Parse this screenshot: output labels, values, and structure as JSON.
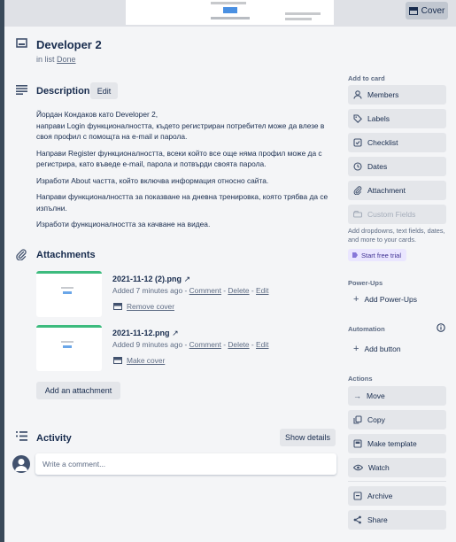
{
  "header": {
    "cover_label": "Cover"
  },
  "card": {
    "title": "Developer 2",
    "list_prefix": "in list",
    "list_name": "Done"
  },
  "description": {
    "title": "Description",
    "edit_label": "Edit",
    "paragraphs": [
      "Йордан Кондаков като Developer 2,",
      "направи Login функционалността, където регистриран потребител може да влезе в своя профил с помощта на e-mail и парола.",
      "Направи Register функционалността, всеки който все още няма профил може да с регистрира, като въведе e-mail, парола и потвърди своята парола.",
      "Изработи About частта, който включва информация относно сайта.",
      "Направи функционалността за показване на дневна тренировка, която трябва да се изпълни.",
      "Изработи функционалността за качване на видеа."
    ]
  },
  "attachments": {
    "title": "Attachments",
    "items": [
      {
        "name": "2021-11-12 (2).png",
        "added": "Added 7 minutes ago",
        "comment": "Comment",
        "delete": "Delete",
        "edit": "Edit",
        "cover_action": "Remove cover",
        "sep": "-"
      },
      {
        "name": "2021-11-12.png",
        "added": "Added 9 minutes ago",
        "comment": "Comment",
        "delete": "Delete",
        "edit": "Edit",
        "cover_action": "Make cover",
        "sep": "-"
      }
    ],
    "add_label": "Add an attachment"
  },
  "activity": {
    "title": "Activity",
    "show_details": "Show details",
    "comment_placeholder": "Write a comment..."
  },
  "sidebar": {
    "add_to_card_label": "Add to card",
    "add_to_card": [
      {
        "label": "Members",
        "icon": "person-icon"
      },
      {
        "label": "Labels",
        "icon": "tag-icon"
      },
      {
        "label": "Checklist",
        "icon": "checkbox-icon"
      },
      {
        "label": "Dates",
        "icon": "clock-icon"
      },
      {
        "label": "Attachment",
        "icon": "paperclip-icon"
      },
      {
        "label": "Custom Fields",
        "icon": "custom-fields-icon"
      }
    ],
    "custom_fields_note": "Add dropdowns, text fields, dates, and more to your cards.",
    "trial_label": "Start free trial",
    "powerups_label": "Power-Ups",
    "add_powerups": "Add Power-Ups",
    "automation_label": "Automation",
    "add_button": "Add button",
    "actions_label": "Actions",
    "actions": [
      {
        "label": "Move",
        "icon": "arrow-right-icon"
      },
      {
        "label": "Copy",
        "icon": "copy-icon"
      },
      {
        "label": "Make template",
        "icon": "template-icon"
      },
      {
        "label": "Watch",
        "icon": "eye-icon"
      },
      {
        "label": "Archive",
        "icon": "archive-icon"
      },
      {
        "label": "Share",
        "icon": "share-icon"
      }
    ]
  },
  "colors": {
    "modal_bg": "#f4f5f7",
    "button_bg": "#e4e6ea",
    "text_primary": "#172b4d",
    "text_secondary": "#5e6c84",
    "trial_bg": "#eae6ff",
    "trial_text": "#403294"
  }
}
